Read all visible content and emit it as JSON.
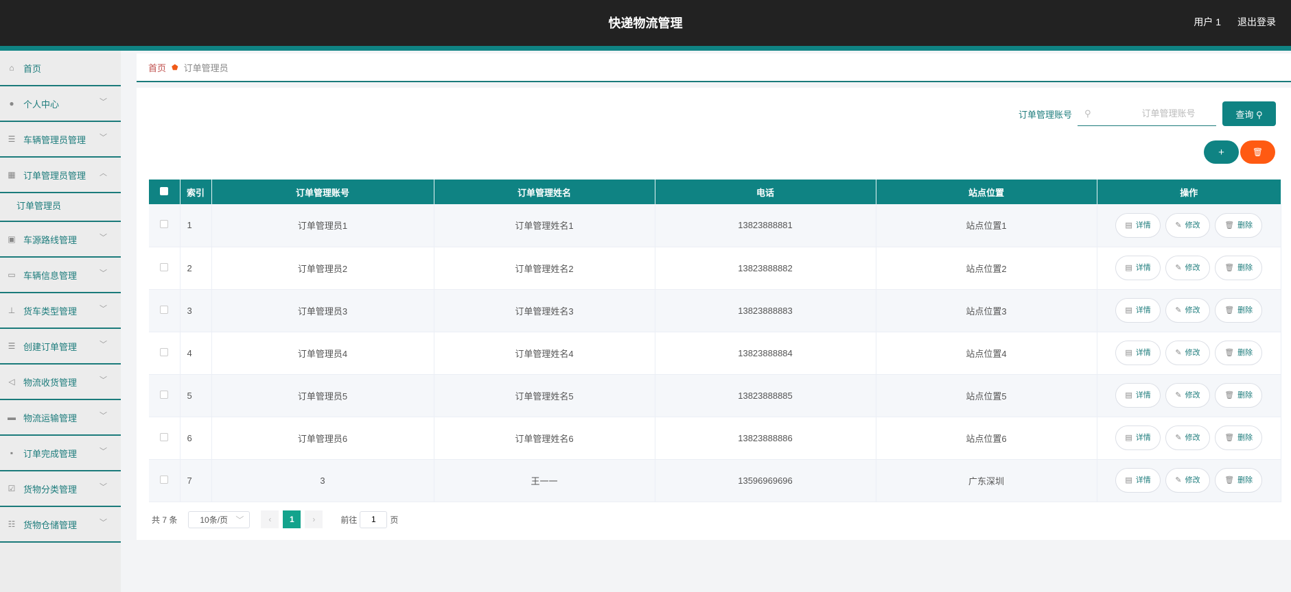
{
  "header": {
    "title": "快递物流管理",
    "user": "用户 1",
    "logout": "退出登录"
  },
  "sidebar": {
    "items": [
      {
        "label": "首页",
        "icon": "home-icon",
        "glyph": "⌂",
        "chev": ""
      },
      {
        "label": "个人中心",
        "icon": "user-icon",
        "glyph": "●",
        "chev": "﹀"
      },
      {
        "label": "车辆管理员管理",
        "icon": "list-icon",
        "glyph": "☰",
        "chev": "﹀"
      },
      {
        "label": "订单管理员管理",
        "icon": "grid-icon",
        "glyph": "▦",
        "chev": "︿"
      },
      {
        "label": "车源路线管理",
        "icon": "clipboard-icon",
        "glyph": "▣",
        "chev": "﹀"
      },
      {
        "label": "车辆信息管理",
        "icon": "card-icon",
        "glyph": "▭",
        "chev": "﹀"
      },
      {
        "label": "货车类型管理",
        "icon": "stamp-icon",
        "glyph": "⊥",
        "chev": "﹀"
      },
      {
        "label": "创建订单管理",
        "icon": "indent-icon",
        "glyph": "☰",
        "chev": "﹀"
      },
      {
        "label": "物流收货管理",
        "icon": "send-icon",
        "glyph": "◁",
        "chev": "﹀"
      },
      {
        "label": "物流运输管理",
        "icon": "box-icon",
        "glyph": "▬",
        "chev": "﹀"
      },
      {
        "label": "订单完成管理",
        "icon": "blocks-icon",
        "glyph": "▪",
        "chev": "﹀"
      },
      {
        "label": "货物分类管理",
        "icon": "checklist-icon",
        "glyph": "☑",
        "chev": "﹀"
      },
      {
        "label": "货物仓储管理",
        "icon": "sliders-icon",
        "glyph": "☷",
        "chev": "﹀"
      }
    ],
    "sub": "订单管理员"
  },
  "breadcrumb": {
    "home": "首页",
    "current": "订单管理员"
  },
  "search": {
    "label": "订单管理账号",
    "placeholder": "订单管理账号",
    "value": "",
    "button": "查询 ⚲"
  },
  "actions": {
    "add": "+",
    "delete": "🗑"
  },
  "table": {
    "headers": [
      "索引",
      "订单管理账号",
      "订单管理姓名",
      "电话",
      "站点位置",
      "操作"
    ],
    "rows": [
      [
        "1",
        "订单管理员1",
        "订单管理姓名1",
        "13823888881",
        "站点位置1"
      ],
      [
        "2",
        "订单管理员2",
        "订单管理姓名2",
        "13823888882",
        "站点位置2"
      ],
      [
        "3",
        "订单管理员3",
        "订单管理姓名3",
        "13823888883",
        "站点位置3"
      ],
      [
        "4",
        "订单管理员4",
        "订单管理姓名4",
        "13823888884",
        "站点位置4"
      ],
      [
        "5",
        "订单管理员5",
        "订单管理姓名5",
        "13823888885",
        "站点位置5"
      ],
      [
        "6",
        "订单管理员6",
        "订单管理姓名6",
        "13823888886",
        "站点位置6"
      ],
      [
        "7",
        "3",
        "王一一",
        "13596969696",
        "广东深圳"
      ]
    ],
    "ops": {
      "detail": "详情",
      "edit": "修改",
      "delete": "删除"
    }
  },
  "pagination": {
    "total": "共 7 条",
    "size": "10条/页",
    "current": "1",
    "goto_label": "前往",
    "goto_value": "1",
    "page_unit": "页"
  },
  "colors": {
    "teal": "#0f8383",
    "orange": "#ff5a12",
    "header": "#222222"
  }
}
